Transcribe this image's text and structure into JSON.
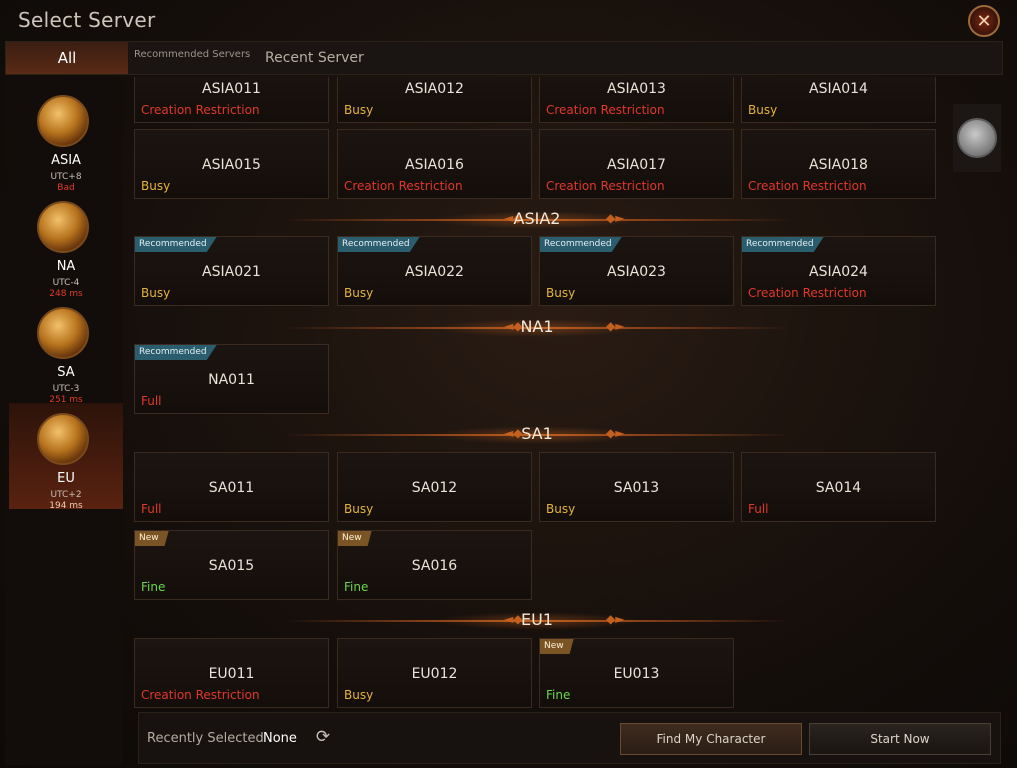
{
  "window": {
    "title": "Select Server",
    "close_icon": "close-icon"
  },
  "tabs": {
    "all": "All",
    "recommended": "Recommended Servers",
    "recent": "Recent Server"
  },
  "regions": [
    {
      "name": "ASIA",
      "utc": "UTC+8",
      "ping": "Bad"
    },
    {
      "name": "NA",
      "utc": "UTC-4",
      "ping": "248 ms"
    },
    {
      "name": "SA",
      "utc": "UTC-3",
      "ping": "251 ms"
    },
    {
      "name": "EU",
      "utc": "UTC+2",
      "ping": "194 ms"
    }
  ],
  "status_colors": {
    "Creation Restriction": "#e0382a",
    "Busy": "#e6b43a",
    "Full": "#e0382a",
    "Fine": "#6ad64a"
  },
  "groups": {
    "asia1_row1": [
      {
        "name": "ASIA011",
        "status": "Creation Restriction"
      },
      {
        "name": "ASIA012",
        "status": "Busy"
      },
      {
        "name": "ASIA013",
        "status": "Creation Restriction"
      },
      {
        "name": "ASIA014",
        "status": "Busy"
      }
    ],
    "asia1_row2": [
      {
        "name": "ASIA015",
        "status": "Busy"
      },
      {
        "name": "ASIA016",
        "status": "Creation Restriction"
      },
      {
        "name": "ASIA017",
        "status": "Creation Restriction"
      },
      {
        "name": "ASIA018",
        "status": "Creation Restriction"
      }
    ],
    "asia2": {
      "label": "ASIA2",
      "servers": [
        {
          "name": "ASIA021",
          "status": "Busy",
          "badge": "Recommended"
        },
        {
          "name": "ASIA022",
          "status": "Busy",
          "badge": "Recommended"
        },
        {
          "name": "ASIA023",
          "status": "Busy",
          "badge": "Recommended"
        },
        {
          "name": "ASIA024",
          "status": "Creation Restriction",
          "badge": "Recommended"
        }
      ]
    },
    "na1": {
      "label": "NA1",
      "servers": [
        {
          "name": "NA011",
          "status": "Full",
          "badge": "Recommended"
        }
      ]
    },
    "sa1": {
      "label": "SA1",
      "servers": [
        {
          "name": "SA011",
          "status": "Full"
        },
        {
          "name": "SA012",
          "status": "Busy"
        },
        {
          "name": "SA013",
          "status": "Busy"
        },
        {
          "name": "SA014",
          "status": "Full"
        },
        {
          "name": "SA015",
          "status": "Fine",
          "badge": "New"
        },
        {
          "name": "SA016",
          "status": "Fine",
          "badge": "New"
        }
      ]
    },
    "eu1": {
      "label": "EU1",
      "servers": [
        {
          "name": "EU011",
          "status": "Creation Restriction"
        },
        {
          "name": "EU012",
          "status": "Busy"
        },
        {
          "name": "EU013",
          "status": "Fine",
          "badge": "New"
        }
      ]
    }
  },
  "footer": {
    "recent_label": "Recently Selected",
    "recent_value": "None",
    "refresh_icon": "refresh-icon",
    "find_button": "Find My Character",
    "start_button": "Start Now"
  }
}
